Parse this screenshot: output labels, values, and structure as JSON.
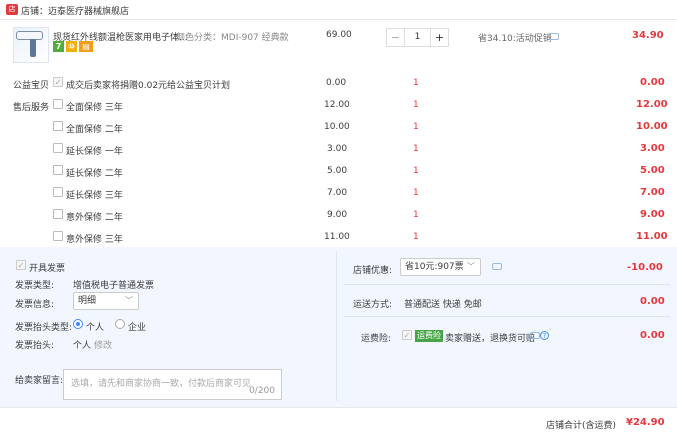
{
  "shop": {
    "label": "店铺：迈泰医疗器械旗舰店"
  },
  "product": {
    "title": "现货红外线额温枪医家用电子体...",
    "sku": "颜色分类：MDI-907 经典款",
    "price": "69.00",
    "quantity": "1",
    "discount": "省34.10:活动促销",
    "total": "34.90",
    "badges": [
      "7",
      "⑩",
      "▤"
    ]
  },
  "charity": {
    "label": "公益宝贝",
    "text": "成交后卖家将捐赠0.02元给公益宝贝计划",
    "price": "0.00",
    "qty": "1",
    "total": "0.00"
  },
  "service": {
    "label": "售后服务",
    "items": [
      {
        "name": "全面保修 三年",
        "price": "12.00",
        "qty": "1",
        "total": "12.00"
      },
      {
        "name": "全面保修 二年",
        "price": "10.00",
        "qty": "1",
        "total": "10.00"
      },
      {
        "name": "延长保修 一年",
        "price": "3.00",
        "qty": "1",
        "total": "3.00"
      },
      {
        "name": "延长保修 二年",
        "price": "5.00",
        "qty": "1",
        "total": "5.00"
      },
      {
        "name": "延长保修 三年",
        "price": "7.00",
        "qty": "1",
        "total": "7.00"
      },
      {
        "name": "意外保修 二年",
        "price": "9.00",
        "qty": "1",
        "total": "9.00"
      },
      {
        "name": "意外保修 三年",
        "price": "11.00",
        "qty": "1",
        "total": "11.00"
      }
    ]
  },
  "invoice": {
    "open_label": "开具发票",
    "type_label": "发票类型:",
    "type_value": "增值税电子普通发票",
    "info_label": "发票信息:",
    "info_value": "明细",
    "header_type_label": "发票抬头类型:",
    "header_options": [
      "个人",
      "企业"
    ],
    "header_label": "发票抬头:",
    "header_value": "个人",
    "edit_label": "修改"
  },
  "message": {
    "label": "给卖家留言:",
    "placeholder": "选填，请先和商家协商一致，付款后商家可见",
    "counter": "0/200"
  },
  "shop_discount": {
    "label": "店铺优惠:",
    "value": "省10元:907票",
    "amount": "-10.00"
  },
  "shipping": {
    "label": "运送方式:",
    "value": "普通配送 快递 免邮",
    "amount": "0.00"
  },
  "insurance": {
    "label": "运费险:",
    "tag": "运费险",
    "text": "卖家赠送，退换货可赔",
    "amount": "0.00"
  },
  "footer": {
    "label": "店铺合计(含运费)",
    "total": "¥24.90"
  },
  "colors": {
    "accent": "#e4393c",
    "panel": "#f2f7ff",
    "link": "#3d8af7"
  }
}
